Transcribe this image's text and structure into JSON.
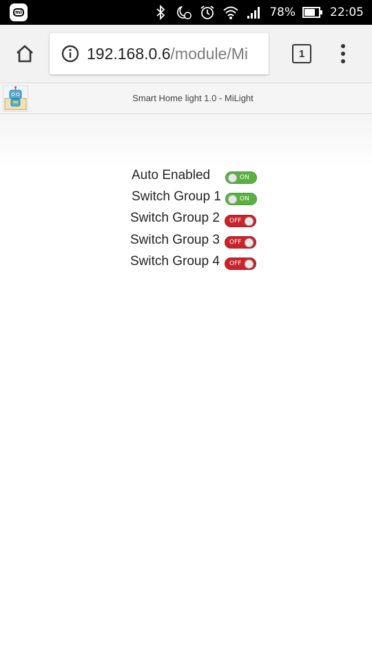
{
  "status_bar": {
    "battery_percent": "78%",
    "time": "22:05",
    "icons": [
      "mi-app-icon",
      "bluetooth-icon",
      "moon-alarm-icon",
      "alarm-icon",
      "wifi-icon",
      "signal-icon",
      "battery-icon"
    ]
  },
  "browser": {
    "url_host": "192.168.0.6",
    "url_path": "/module/Mi",
    "tab_count": "1",
    "icons": [
      "home-icon",
      "info-icon",
      "tabs-icon",
      "more-menu-icon"
    ]
  },
  "page": {
    "header_title": "Smart Home light 1.0 - MiLight",
    "controls": [
      {
        "label": "Auto Enabled",
        "state": "ON"
      },
      {
        "label": "Switch Group 1",
        "state": "ON"
      },
      {
        "label": "Switch Group 2",
        "state": "OFF"
      },
      {
        "label": "Switch Group 3",
        "state": "OFF"
      },
      {
        "label": "Switch Group 4",
        "state": "OFF"
      }
    ]
  },
  "colors": {
    "toggle_on": "#5cb041",
    "toggle_off": "#c9232c",
    "status_bar": "#000000",
    "toolbar": "#f2f2f2"
  }
}
